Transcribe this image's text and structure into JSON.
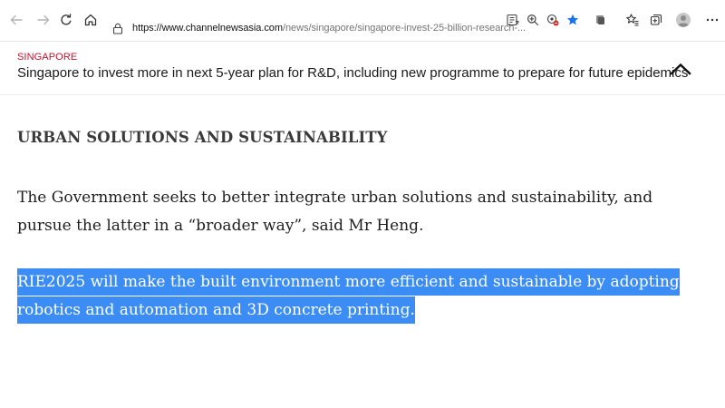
{
  "browser": {
    "url_domain": "https://www.channelnewsasia.com",
    "url_path": "/news/singapore/singapore-invest-25-billion-research-...",
    "icons": {
      "back": "back-arrow-icon",
      "forward": "forward-arrow-icon",
      "refresh": "refresh-icon",
      "home": "home-icon",
      "lock": "lock-icon",
      "reader": "reader-view-icon",
      "zoom": "zoom-icon",
      "tracking": "tracking-prevention-icon",
      "favorite": "star-icon",
      "extensions": "extensions-icon",
      "favorites_bar": "favorites-icon",
      "collections": "collections-icon",
      "profile": "profile-avatar-icon",
      "menu": "more-menu-icon"
    },
    "colors": {
      "favorite_star": "#1a73e8",
      "tracking_badge": "#d93025"
    }
  },
  "article_header": {
    "section": "SINGAPORE",
    "title": "Singapore to invest more in next 5-year plan for R&D, including new programme to prepare for future epidemics",
    "collapse_icon": "chevron-up-icon",
    "section_color": "#c0152f"
  },
  "article": {
    "heading": "URBAN SOLUTIONS AND SUSTAINABILITY",
    "paragraph_1": "The Government seeks to better integrate urban solutions and sustainability, and pursue the latter in a “broader way”, said Mr Heng.",
    "paragraph_2": "RIE2025 will make the built environment more efficient and sustainable by adopting robotics and automation and 3D concrete printing.",
    "selection_color": "#3b8df5"
  }
}
